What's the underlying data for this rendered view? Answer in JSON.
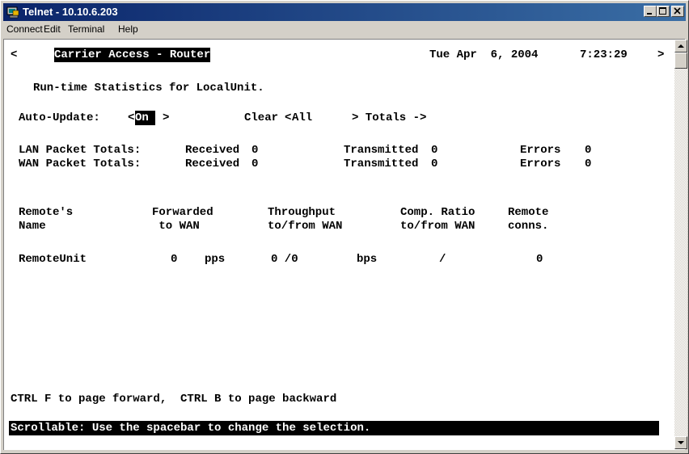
{
  "window": {
    "title": "Telnet - 10.10.6.203",
    "icon": "telnet-terminal-icon",
    "controls": {
      "minimize": "minimize-icon",
      "maximize": "maximize-icon",
      "close": "close-icon"
    }
  },
  "menu": {
    "items": [
      "Connect",
      "Edit",
      "Terminal",
      "Help"
    ]
  },
  "terminal": {
    "header": {
      "left_marker": "<",
      "product": "Carrier Access - Router",
      "date": "Tue Apr  6, 2004",
      "time": "7:23:29",
      "right_marker": ">"
    },
    "page_title": "Run-time Statistics for LocalUnit.",
    "controls": {
      "auto_update_label": "Auto-Update: ",
      "auto_update_open": "<",
      "auto_update_value": "On ",
      "auto_update_close": ">",
      "clear_label": "Clear ",
      "clear_open": "<",
      "clear_value": "All   ",
      "clear_close": "> Totals ->"
    },
    "packet_totals": [
      {
        "label": "LAN Packet Totals:",
        "received_label": "Received",
        "received": "0",
        "transmitted_label": "Transmitted",
        "transmitted": "0",
        "errors_label": "Errors",
        "errors": "0"
      },
      {
        "label": "WAN Packet Totals:",
        "received_label": "Received",
        "received": "0",
        "transmitted_label": "Transmitted",
        "transmitted": "0",
        "errors_label": "Errors",
        "errors": "0"
      }
    ],
    "table": {
      "headers": [
        {
          "line1": "Remote's",
          "line2": "Name"
        },
        {
          "line1": "Forwarded",
          "line2": " to WAN"
        },
        {
          "line1": "Throughput",
          "line2": "to/from WAN"
        },
        {
          "line1": "Comp. Ratio",
          "line2": "to/from WAN"
        },
        {
          "line1": "Remote",
          "line2": "conns."
        }
      ],
      "rows": [
        {
          "name": "RemoteUnit",
          "forwarded": "0",
          "forwarded_unit": "pps",
          "throughput": "0 /0",
          "throughput_unit": "bps",
          "comp_ratio": "/",
          "conns": "0"
        }
      ]
    },
    "paging_hint": "CTRL F to page forward,  CTRL B to page backward",
    "status_bar": "Scrollable: Use the spacebar to change the selection."
  },
  "colors": {
    "title_bar": "#0a246a",
    "window_face": "#d4d0c8",
    "terminal_bg": "#ffffff",
    "terminal_text": "#000000",
    "highlight": "#000000"
  }
}
